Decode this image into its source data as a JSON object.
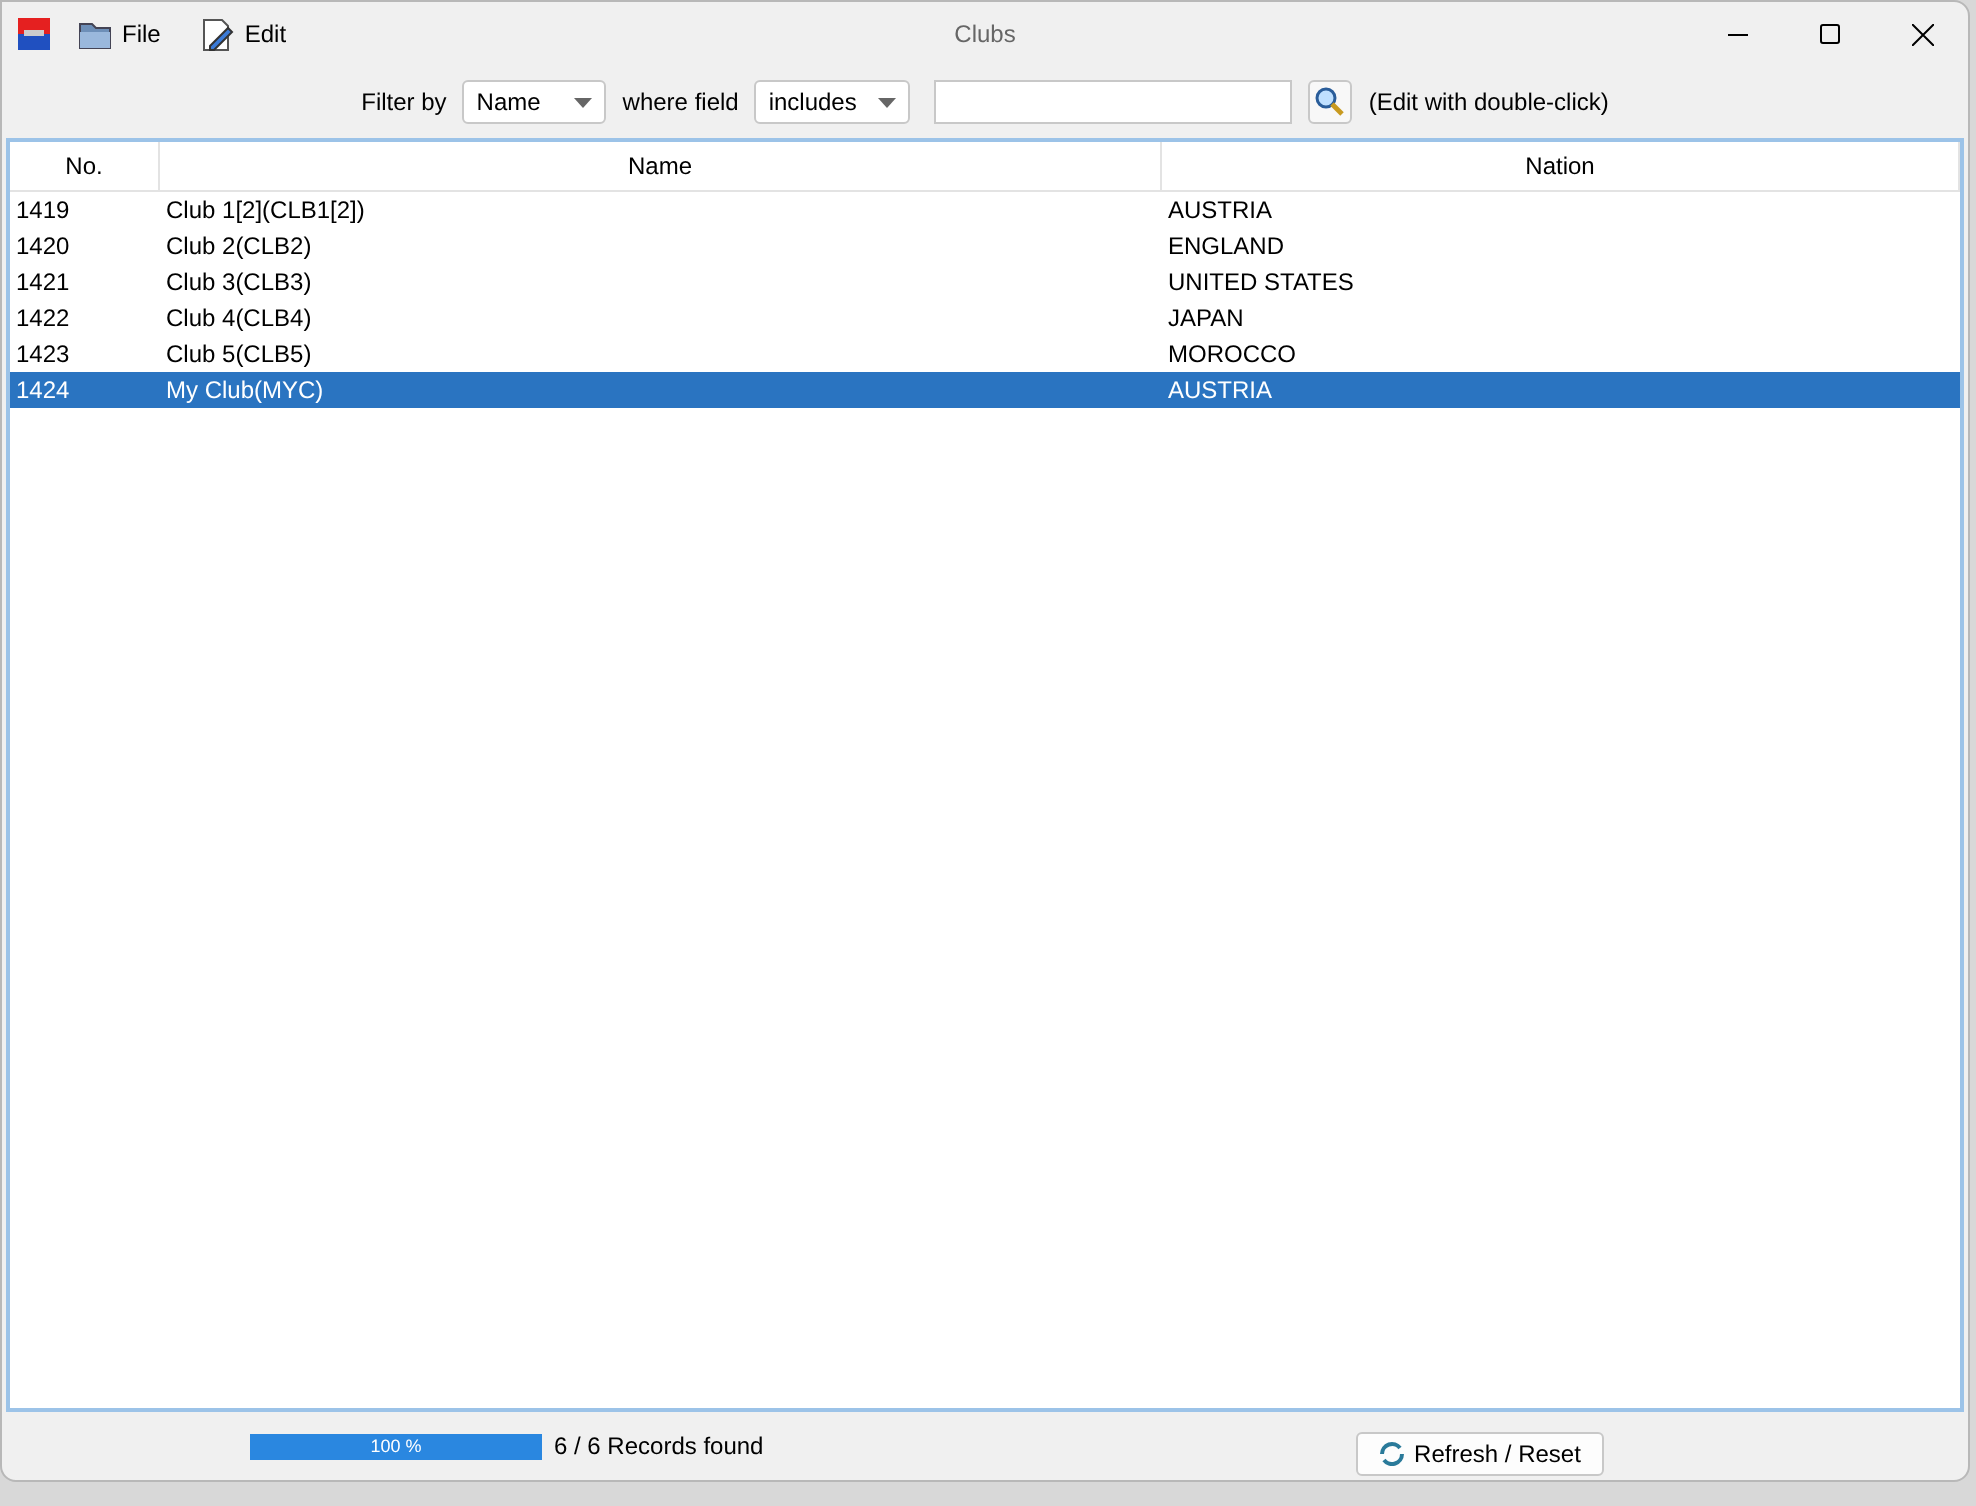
{
  "window": {
    "title": "Clubs"
  },
  "menu": [
    "File",
    "Edit"
  ],
  "filter": {
    "label": "Filter by",
    "field": "Name",
    "where_label": "where field",
    "operator": "includes",
    "hint": "(Edit with double-click)"
  },
  "table": {
    "columns": [
      "No.",
      "Name",
      "Nation"
    ],
    "rows": [
      {
        "cells": [
          "1419",
          "Club 1[2](CLB1[2])",
          "AUSTRIA"
        ],
        "selected": false
      },
      {
        "cells": [
          "1420",
          "Club 2(CLB2)",
          "ENGLAND"
        ],
        "selected": false
      },
      {
        "cells": [
          "1421",
          "Club 3(CLB3)",
          "UNITED STATES"
        ],
        "selected": false
      },
      {
        "cells": [
          "1422",
          "Club 4(CLB4)",
          "JAPAN"
        ],
        "selected": false
      },
      {
        "cells": [
          "1423",
          "Club 5(CLB5)",
          "MOROCCO"
        ],
        "selected": false
      },
      {
        "cells": [
          "1424",
          "My Club(MYC)",
          "AUSTRIA"
        ],
        "selected": true
      }
    ]
  },
  "status": {
    "progress": {
      "level": 1,
      "text": "100 %"
    },
    "records": "6 / 6 Records found",
    "button": "Refresh / Reset"
  }
}
